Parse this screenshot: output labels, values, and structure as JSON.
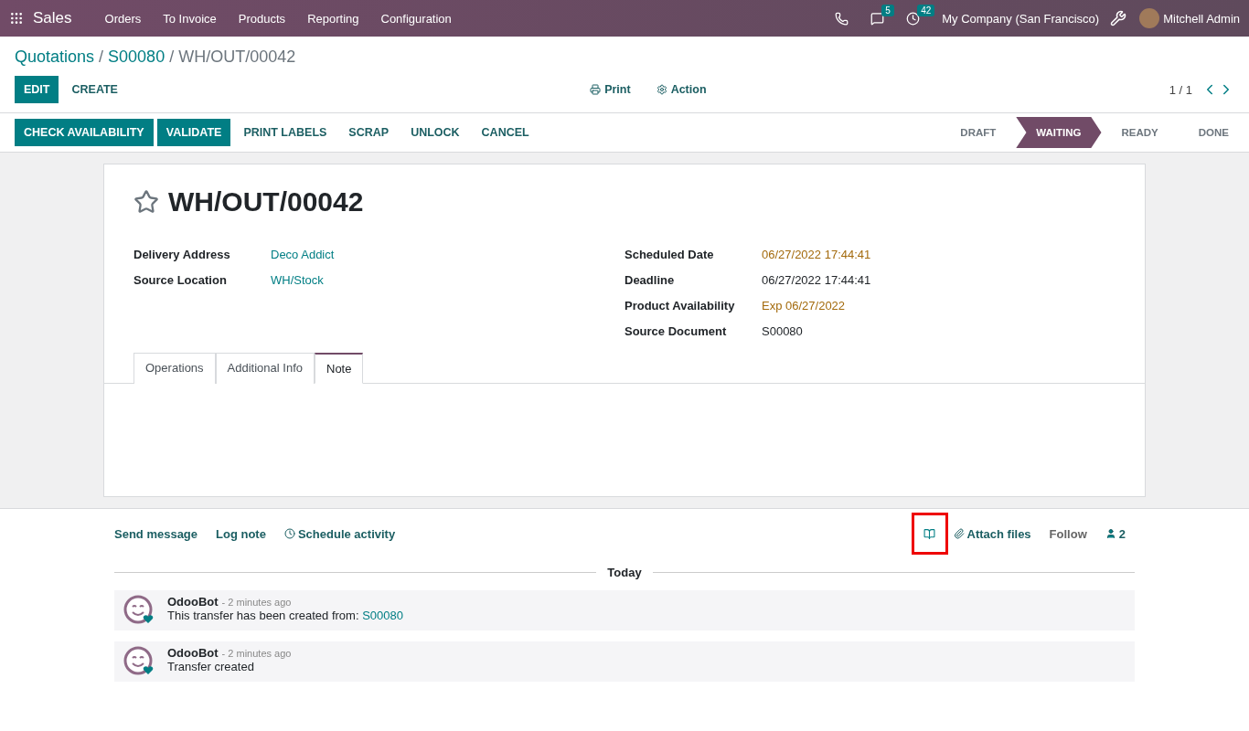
{
  "navbar": {
    "app": "Sales",
    "menus": [
      "Orders",
      "To Invoice",
      "Products",
      "Reporting",
      "Configuration"
    ],
    "messages_badge": "5",
    "activities_badge": "42",
    "company": "My Company (San Francisco)",
    "user": "Mitchell Admin"
  },
  "breadcrumbs": [
    {
      "label": "Quotations",
      "link": true
    },
    {
      "separator": "/",
      "label": "S00080",
      "link": true
    },
    {
      "separator": "/",
      "label": "WH/OUT/00042",
      "link": false
    }
  ],
  "control_buttons": [
    {
      "label": "EDIT",
      "primary": true
    },
    {
      "label": "CREATE",
      "primary": false
    }
  ],
  "center_actions": [
    {
      "label": "Print",
      "kind": "print"
    },
    {
      "label": "Action",
      "kind": "gear"
    }
  ],
  "pager": "1 / 1",
  "status_buttons": [
    {
      "label": "CHECK AVAILABILITY",
      "primary": true
    },
    {
      "label": "VALIDATE",
      "primary": true
    },
    {
      "label": "PRINT LABELS",
      "primary": false
    },
    {
      "label": "SCRAP",
      "primary": false
    },
    {
      "label": "UNLOCK",
      "primary": false
    },
    {
      "label": "CANCEL",
      "primary": false
    }
  ],
  "stages": [
    {
      "label": "DRAFT",
      "selected": false
    },
    {
      "label": "WAITING",
      "selected": true
    },
    {
      "label": "READY",
      "selected": false
    },
    {
      "label": "DONE",
      "selected": false
    }
  ],
  "record": {
    "title": "WH/OUT/00042",
    "starred": false,
    "left_fields": [
      {
        "label": "Delivery Address",
        "value": "Deco Addict",
        "kind": "link"
      },
      {
        "label": "Source Location",
        "value": "WH/Stock",
        "kind": "link"
      }
    ],
    "right_fields": [
      {
        "label": "Scheduled Date",
        "value": "06/27/2022 17:44:41",
        "kind": "warning"
      },
      {
        "label": "Deadline",
        "value": "06/27/2022 17:44:41",
        "kind": "text"
      },
      {
        "label": "Product Availability",
        "value": "Exp 06/27/2022",
        "kind": "warning"
      },
      {
        "label": "Source Document",
        "value": "S00080",
        "kind": "text"
      }
    ],
    "tabs": [
      {
        "label": "Operations",
        "selected": false
      },
      {
        "label": "Additional Info",
        "selected": false
      },
      {
        "label": "Note",
        "selected": true
      }
    ]
  },
  "chatter": {
    "actions": [
      {
        "label": "Send message",
        "kind": "plain"
      },
      {
        "label": "Log note",
        "kind": "plain"
      },
      {
        "label": "Schedule activity",
        "kind": "clock"
      }
    ],
    "knowledge_highlighted": true,
    "attach": "Attach files",
    "follow": "Follow",
    "followers": "2",
    "date_separator": "Today",
    "messages": [
      {
        "author": "OdooBot",
        "time": "- 2 minutes ago",
        "body": "This transfer has been created from:",
        "link": "S00080"
      },
      {
        "author": "OdooBot",
        "time": "- 2 minutes ago",
        "body": "Transfer created"
      }
    ]
  }
}
